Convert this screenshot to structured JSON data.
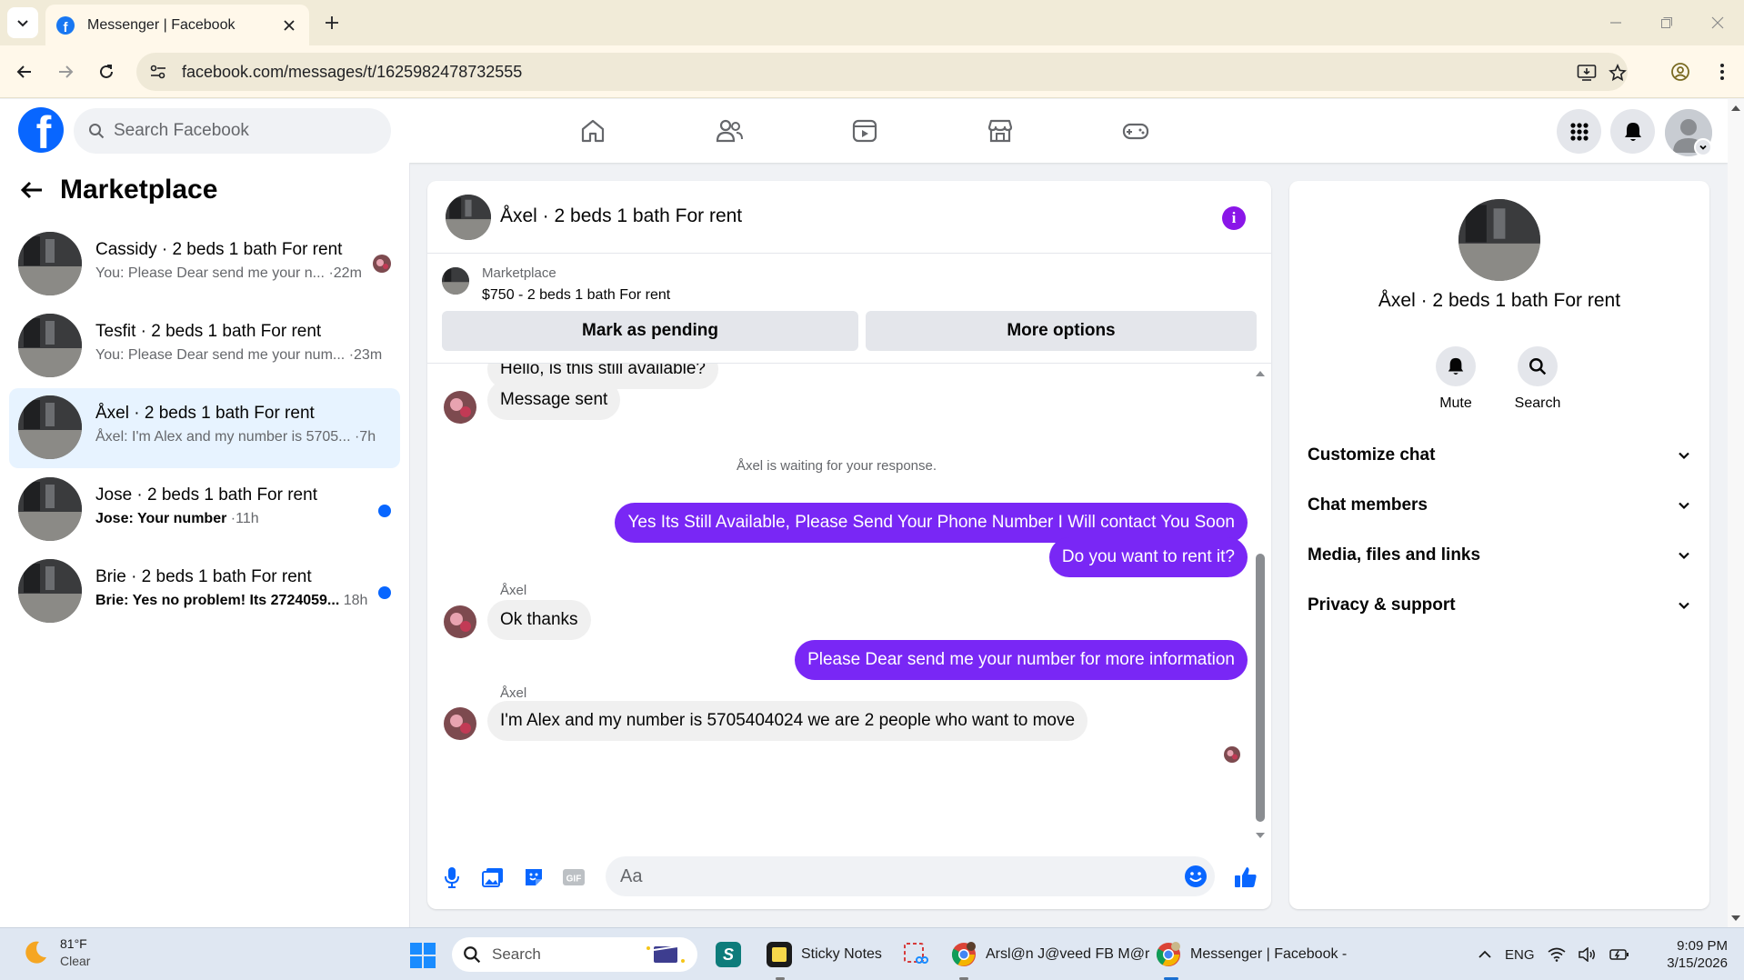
{
  "browser": {
    "tab_title": "Messenger | Facebook",
    "url": "facebook.com/messages/t/1625982478732555"
  },
  "header": {
    "search_placeholder": "Search Facebook",
    "nav_icons": [
      "home-icon",
      "friends-icon",
      "video-icon",
      "marketplace-icon",
      "gaming-icon"
    ]
  },
  "sidebar": {
    "title": "Marketplace",
    "conversations": [
      {
        "name": "Cassidy · 2 beds 1 bath For rent",
        "preview": "You: Please Dear send me your n...",
        "time": "·22m",
        "unread": false,
        "seen_avatar": true
      },
      {
        "name": "Tesfit · 2 beds 1 bath For rent",
        "preview": "You: Please Dear send me your num...",
        "time": "·23m",
        "unread": false,
        "seen_avatar": false
      },
      {
        "name": "Åxel · 2 beds 1 bath For rent",
        "preview": "Åxel: I'm Alex and my number is 5705...",
        "time": "·7h",
        "unread": false,
        "active": true
      },
      {
        "name": "Jose · 2 beds 1 bath For rent",
        "preview": "Jose: Your number",
        "time": "·11h",
        "unread": true
      },
      {
        "name": "Brie · 2 beds 1 bath For rent",
        "preview": "Brie: Yes no problem! Its 2724059...",
        "time": "18h",
        "unread": true
      }
    ]
  },
  "chat": {
    "title": "Åxel · 2 beds 1 bath For rent",
    "listing_label": "Marketplace",
    "listing_price": "$750 - 2 beds 1 bath For rent",
    "mark_pending_label": "Mark as pending",
    "more_options_label": "More options",
    "partial_message": "Hello, is this still available?",
    "message_sent": "Message sent",
    "waiting_text": "Åxel is waiting for your response.",
    "outgoing_1": "Yes Its Still Available, Please Send Your Phone Number I Will contact You Soon",
    "outgoing_2": "Do you want to rent it?",
    "sender_1": "Åxel",
    "incoming_1": "Ok thanks",
    "outgoing_3": "Please Dear send me your number for more information",
    "sender_2": "Åxel",
    "incoming_2": "I'm Alex and my number is 5705404024 we are 2 people who want to move",
    "composer_placeholder": "Aa"
  },
  "details": {
    "title": "Åxel · 2 beds 1 bath For rent",
    "mute_label": "Mute",
    "search_label": "Search",
    "sections": [
      "Customize chat",
      "Chat members",
      "Media, files and links",
      "Privacy & support"
    ]
  },
  "taskbar": {
    "temperature": "81°F",
    "condition": "Clear",
    "search_label": "Search",
    "sticky_notes": "Sticky Notes",
    "chrome_app_1": "Arsl@n J@veed FB M@r",
    "chrome_app_2": "Messenger | Facebook -",
    "language": "ENG",
    "time": "9:09 PM",
    "date": "3/15/2026"
  },
  "colors": {
    "brand_blue": "#0866ff",
    "outgoing_bubble": "#7927f5",
    "info_icon": "#8a16e8",
    "active_conversation": "#e7f3ff"
  }
}
